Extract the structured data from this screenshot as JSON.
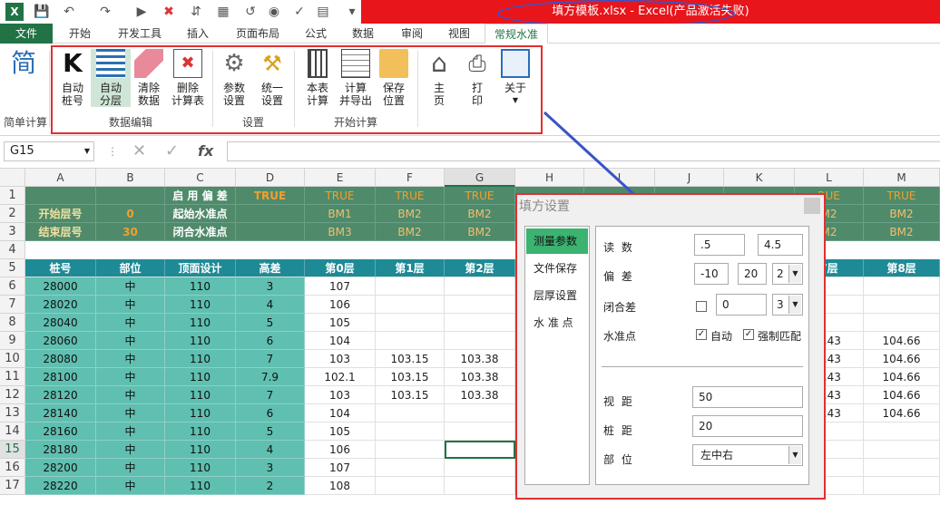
{
  "window": {
    "title": "填方模板.xlsx - Excel(产品激活失败)"
  },
  "tabs": {
    "file": "文件",
    "t1": "开始",
    "t2": "开发工具",
    "t3": "插入",
    "t4": "页面布局",
    "t5": "公式",
    "t6": "数据",
    "t7": "审阅",
    "t8": "视图",
    "active": "常规水准"
  },
  "ribbon": {
    "simple_icon": "简",
    "simple_group": "简单计算",
    "b1": "自动\n桩号",
    "b2": "自动\n分层",
    "b3": "清除\n数据",
    "b4": "删除\n计算表",
    "g1": "数据编辑",
    "b5": "参数\n设置",
    "b6": "统一\n设置",
    "g2": "设置",
    "b7": "本表\n计算",
    "b8": "计算\n并导出",
    "b9": "保存\n位置",
    "g3": "开始计算",
    "b10": "主\n页",
    "b11": "打\n印",
    "b12": "关于"
  },
  "formula_bar": {
    "name_box": "G15",
    "fx": "fx",
    "value": ""
  },
  "sheet": {
    "columns": [
      "A",
      "B",
      "C",
      "D",
      "E",
      "F",
      "G",
      "H",
      "I",
      "J",
      "K",
      "L",
      "M"
    ],
    "rows": [
      "1",
      "2",
      "3",
      "4",
      "5",
      "6",
      "7",
      "8",
      "9",
      "10",
      "11",
      "12",
      "13",
      "14",
      "15",
      "16",
      "17"
    ],
    "r1": {
      "c": "启 用 偏 差",
      "d": "TRUE",
      "e": "TRUE",
      "f": "TRUE",
      "g": "TRUE",
      "l": "RUE",
      "m": "TRUE"
    },
    "r2": {
      "a": "开始层号",
      "b": "0",
      "c": "起始水准点",
      "e": "BM1",
      "f": "BM2",
      "g": "BM2",
      "l": "M2",
      "m": "BM2"
    },
    "r3": {
      "a": "结束层号",
      "b": "30",
      "c": "闭合水准点",
      "e": "BM3",
      "f": "BM2",
      "g": "BM2",
      "l": "M2",
      "m": "BM2"
    },
    "r5": {
      "a": "桩号",
      "b": "部位",
      "c": "顶面设计",
      "d": "高差",
      "e": "第0层",
      "f": "第1层",
      "g": "第2层",
      "l": "7层",
      "m": "第8层"
    },
    "data": [
      [
        "28000",
        "中",
        "110",
        "3",
        "107",
        "",
        "",
        "",
        ""
      ],
      [
        "28020",
        "中",
        "110",
        "4",
        "106",
        "",
        "",
        "",
        ""
      ],
      [
        "28040",
        "中",
        "110",
        "5",
        "105",
        "",
        "",
        "",
        ""
      ],
      [
        "28060",
        "中",
        "110",
        "6",
        "104",
        "",
        "",
        "4.43",
        "104.66"
      ],
      [
        "28080",
        "中",
        "110",
        "7",
        "103",
        "103.15",
        "103.38",
        "4.43",
        "104.66"
      ],
      [
        "28100",
        "中",
        "110",
        "7.9",
        "102.1",
        "103.15",
        "103.38",
        "4.43",
        "104.66"
      ],
      [
        "28120",
        "中",
        "110",
        "7",
        "103",
        "103.15",
        "103.38",
        "4.43",
        "104.66"
      ],
      [
        "28140",
        "中",
        "110",
        "6",
        "104",
        "",
        "",
        "4.43",
        "104.66"
      ],
      [
        "28160",
        "中",
        "110",
        "5",
        "105",
        "",
        "",
        "",
        ""
      ],
      [
        "28180",
        "中",
        "110",
        "4",
        "106",
        "",
        "",
        "",
        ""
      ],
      [
        "28200",
        "中",
        "110",
        "3",
        "107",
        "",
        "",
        "",
        ""
      ],
      [
        "28220",
        "中",
        "110",
        "2",
        "108",
        "",
        "",
        "",
        ""
      ]
    ]
  },
  "dialog": {
    "title": "填方设置",
    "nav": [
      "测量参数",
      "文件保存",
      "层厚设置",
      "水 准 点"
    ],
    "read_label": "读 数",
    "read1": ".5",
    "read2": "4.5",
    "dev_label": "偏 差",
    "dev1": "-10",
    "dev2": "20",
    "dev3": "2",
    "close_label": "闭合差",
    "close_val": "0",
    "close_sel": "3",
    "bm_label": "水准点",
    "auto": "自动",
    "force": "强制匹配",
    "sight_label": "视 距",
    "sight_val": "50",
    "stake_label": "桩 距",
    "stake_val": "20",
    "part_label": "部 位",
    "part_val": "左中右"
  },
  "colors": {
    "green": "#4f8a6a",
    "teal": "#1e8a96",
    "cyan": "#5fbfb0",
    "orange": "#f0a030",
    "excel": "#217346",
    "red": "#e8151b"
  }
}
